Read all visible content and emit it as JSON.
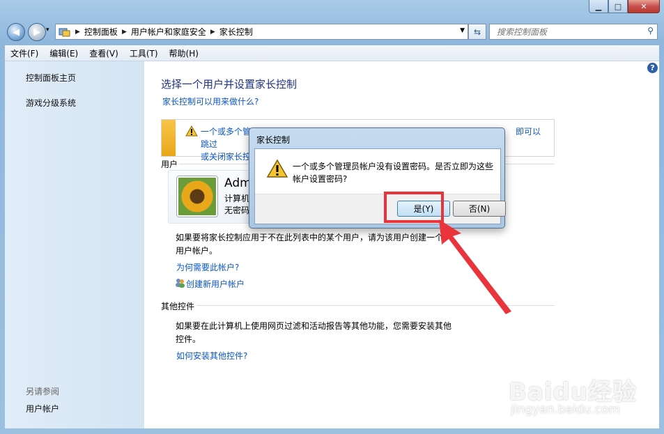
{
  "window": {
    "caption_buttons": {
      "minimize": "▁",
      "maximize": "□",
      "close": "✕"
    },
    "nav": {
      "back": "◀",
      "forward": "▶",
      "history": "▾"
    },
    "breadcrumb": [
      "控制面板",
      "用户帐户和家庭安全",
      "家长控制"
    ],
    "search_placeholder": "搜索控制面板"
  },
  "menu": [
    "文件(F)",
    "编辑(E)",
    "查看(V)",
    "工具(T)",
    "帮助(H)"
  ],
  "sidebar": {
    "items": [
      "控制面板主页",
      "游戏分级系统"
    ],
    "see_also_heading": "另请参阅",
    "see_also_items": [
      "用户帐户"
    ]
  },
  "main": {
    "help": "?",
    "title": "选择一个用户并设置家长控制",
    "what_link": "家长控制可以用来做什么?",
    "warning_line1_start": "一个或多个管",
    "warning_line1_end": "即可以跳过",
    "warning_line2": "或关闭家长控",
    "users_section": "用户",
    "user": {
      "name": "Adm",
      "type": "计算机",
      "password": "无密码"
    },
    "create_desc_line1": "如果要将家长控制应用于不在此列表中的某个用户，请为该用户创建一个",
    "create_desc_line2": "用户帐户。",
    "why_link": "为何需要此帐户?",
    "create_link": "创建新用户帐户",
    "other_section": "其他控件",
    "other_desc_line1": "如果要在此计算机上使用网页过滤和活动报告等其他功能，您需要安装其他",
    "other_desc_line2": "控件。",
    "install_link": "如何安装其他控件?"
  },
  "dialog": {
    "title": "家长控制",
    "message_line1": "一个或多个管理员帐户没有设置密码。是否立即为这些",
    "message_line2": "帐户设置密码?",
    "yes": "是(Y)",
    "no": "否(N)"
  },
  "watermark": {
    "line1": "Baidu经验",
    "line2": "jingyan.baidu.com"
  },
  "colors": {
    "highlight": "#e8343a",
    "link": "#0b57c4",
    "title": "#1e3287"
  }
}
